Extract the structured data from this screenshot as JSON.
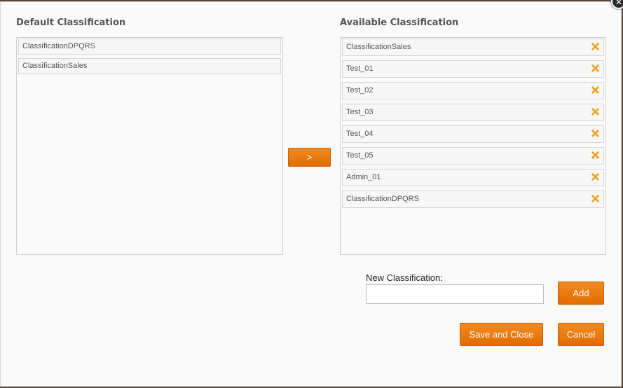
{
  "dialog": {
    "close_glyph": "✕"
  },
  "default_classification": {
    "title": "Default Classification",
    "items": [
      "ClassificationDPQRS",
      "ClassificationSales"
    ]
  },
  "move_button": {
    "label": ">"
  },
  "available_classification": {
    "title": "Available Classification",
    "items": [
      "ClassificationSales",
      "Test_01",
      "Test_02",
      "Test_03",
      "Test_04",
      "Test_05",
      "Admin_01",
      "ClassificationDPQRS"
    ],
    "remove_icon": "remove-x-icon"
  },
  "new_classification": {
    "label": "New Classification:",
    "value": "",
    "placeholder": "",
    "add_label": "Add"
  },
  "footer": {
    "save_label": "Save and Close",
    "cancel_label": "Cancel"
  },
  "colors": {
    "accent": "#ef7d10",
    "remove_icon": "#f0a020"
  }
}
